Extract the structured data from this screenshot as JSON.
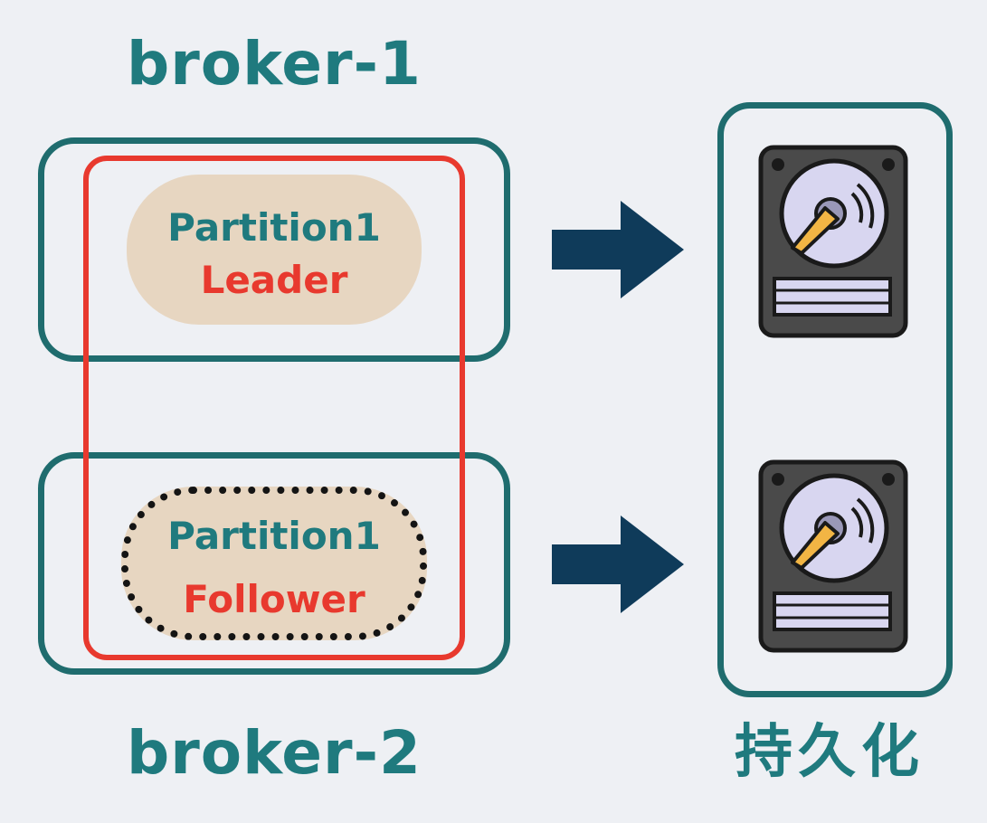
{
  "brokers": [
    {
      "title": "broker-1",
      "partition": {
        "name": "Partition1",
        "role": "Leader"
      }
    },
    {
      "title": "broker-2",
      "partition": {
        "name": "Partition1",
        "role": "Follower"
      }
    }
  ],
  "storage": {
    "title": "持久化",
    "disks": [
      "hard-disk-icon",
      "hard-disk-icon"
    ]
  },
  "colors": {
    "background": "#eef0f4",
    "teal": "#1f7a7e",
    "box_border": "#1f6c6e",
    "red": "#e8392e",
    "pill": "#e7d6c1",
    "arrow": "#0f3b5a",
    "disk_body": "#4a4a4a",
    "disk_platter": "#d8d6f0",
    "disk_arm": "#f2b544"
  }
}
